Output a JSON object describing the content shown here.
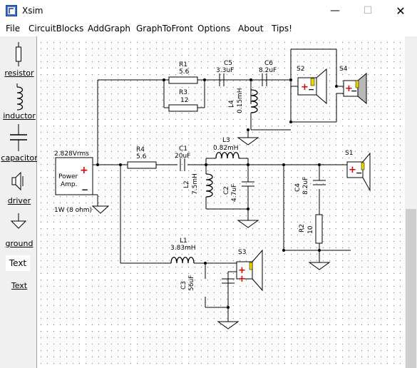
{
  "window": {
    "title": "Xsim",
    "controls": {
      "minimize": "—",
      "maximize": "☐",
      "close": "✕"
    }
  },
  "menu": {
    "items": [
      "File",
      "CircuitBlocks",
      "AddGraph",
      "GraphToFront",
      "Options",
      "About",
      "Tips!"
    ]
  },
  "palette": {
    "items": [
      "resistor",
      "inductor",
      "capacitor",
      "driver",
      "ground",
      "Text"
    ],
    "text_tool_glyph": "Text"
  },
  "circuit": {
    "amp": {
      "voltage": "2.828Vrms",
      "name_line1": "Power",
      "name_line2": "Amp.",
      "power": "1W (8 ohm)"
    },
    "R1": {
      "name": "R1",
      "value": "5.6"
    },
    "R3": {
      "name": "R3",
      "value": "12"
    },
    "R4": {
      "name": "R4",
      "value": "5.6"
    },
    "R2": {
      "name": "R2",
      "value": "10"
    },
    "C5": {
      "name": "C5",
      "value": "3.3uF"
    },
    "C6": {
      "name": "C6",
      "value": "8.2uF"
    },
    "C1": {
      "name": "C1",
      "value": "20uF"
    },
    "C2": {
      "name": "C2",
      "value": "4.7uF"
    },
    "C4": {
      "name": "C4",
      "value": "8.2uF"
    },
    "C3": {
      "name": "C3",
      "value": "56uF"
    },
    "L4": {
      "name": "L4",
      "value": "0.15mH"
    },
    "L3": {
      "name": "L3",
      "value": "0.82mH"
    },
    "L2": {
      "name": "L2",
      "value": "7.5mH"
    },
    "L1": {
      "name": "L1",
      "value": "3.83mH"
    },
    "S1": "S1",
    "S2": "S2",
    "S3": "S3",
    "S4": "S4"
  }
}
